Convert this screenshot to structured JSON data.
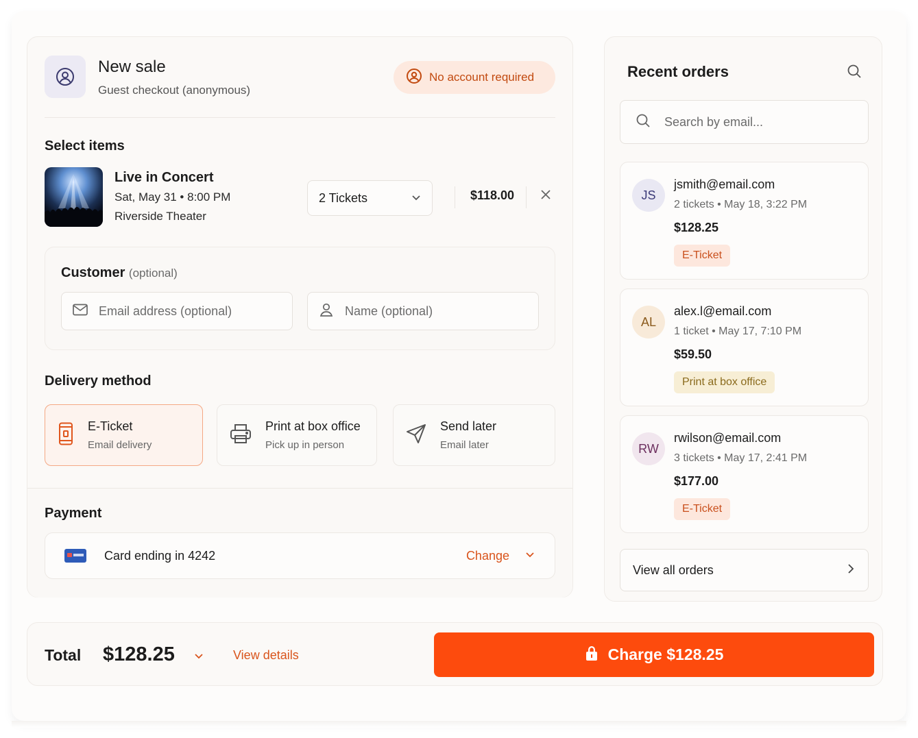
{
  "sale": {
    "title": "New sale",
    "subtitle": "Guest checkout (anonymous)",
    "badge": "No account required"
  },
  "items": {
    "section_title": "Select items",
    "event_name": "Live in Concert",
    "event_datetime": "Sat, May 31 • 8:00 PM",
    "event_venue": "Riverside Theater",
    "quantity_selected": "2 Tickets",
    "price": "$118.00"
  },
  "customer": {
    "title": "Customer",
    "title_suffix": "(optional)",
    "email_placeholder": "Email address (optional)",
    "name_placeholder": "Name (optional)"
  },
  "delivery": {
    "section_title": "Delivery method",
    "selected": "E-Ticket",
    "options": [
      {
        "title": "E-Ticket",
        "subtitle": "Email delivery",
        "icon": "phone-icon"
      },
      {
        "title": "Print at box office",
        "subtitle": "Pick up in person",
        "icon": "printer-icon"
      },
      {
        "title": "Send later",
        "subtitle": "Email later",
        "icon": "send-icon"
      }
    ]
  },
  "payment": {
    "section_title": "Payment",
    "card_label": "Card ending in 4242",
    "change_label": "Change"
  },
  "recent_orders": {
    "title": "Recent orders",
    "search_placeholder": "Search by email...",
    "orders": [
      {
        "initials": "JS",
        "email": "jsmith@email.com",
        "meta": "2 tickets • May 18, 3:22 PM",
        "amount": "$128.25",
        "delivery": "E-Ticket"
      },
      {
        "initials": "AL",
        "email": "alex.l@email.com",
        "meta": "1 ticket • May 17, 7:10 PM",
        "amount": "$59.50",
        "delivery": "Print at box office"
      },
      {
        "initials": "RW",
        "email": "rwilson@email.com",
        "meta": "3 tickets • May 17, 2:41 PM",
        "amount": "$177.00",
        "delivery": "E-Ticket"
      }
    ],
    "view_all_label": "View all orders"
  },
  "footer": {
    "total_label": "Total",
    "total_amount": "$128.25",
    "view_details_label": "View details",
    "charge_label": "Charge $128.25"
  },
  "colors": {
    "accent": "#fd4b0d",
    "accent_text": "#d9541c",
    "badge_bg": "#fde9df"
  }
}
